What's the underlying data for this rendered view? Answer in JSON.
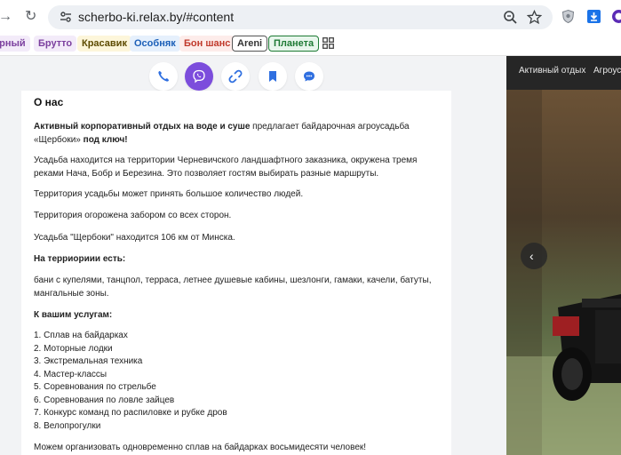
{
  "browser": {
    "url": "scherbo-ki.relax.by/#content"
  },
  "bookmarks": [
    {
      "label": "ерный",
      "color": "#7b3f9e",
      "bg": "#f3ebf9"
    },
    {
      "label": "Брутто",
      "color": "#7b3f9e",
      "bg": "#f3ebf9"
    },
    {
      "label": "Красавик",
      "color": "#5c4a00",
      "bg": "#fdf6da"
    },
    {
      "label": "Особняк",
      "color": "#1b5fb8",
      "bg": "#e6f0fc"
    },
    {
      "label": "Бон шанс",
      "color": "#c0392b",
      "bg": "#fdecea"
    },
    {
      "label": "Areni",
      "color": "#333333",
      "bg": "#ffffff"
    },
    {
      "label": "Планета",
      "color": "#1e7a34",
      "bg": "#e8f6ec"
    }
  ],
  "contacts": [
    "phone-icon",
    "viber-icon",
    "link-icon",
    "bookmark-icon",
    "chat-icon"
  ],
  "right_nav": {
    "item1": "Активный отдых",
    "item2": "Агроус"
  },
  "content": {
    "title": "О нас",
    "intro_bold_1": "Активный корпоративный отдых на воде и суше",
    "intro_mid": " предлагает байдарочная агроусадьба «Щербоки» ",
    "intro_bold_2": "под ключ!",
    "p1": "Усадьба находится на территории Черневичского ландшафтного заказника, окружена тремя реками Нача, Бобр и Березина. Это позволяет гостям выбирать разные маршруты.",
    "p2": "Территория усадьбы может принять большое количество людей.",
    "p3": "Территория огорожена забором со всех сторон.",
    "p4": "Усадьба \"Щербоки\" находится 106 км от Минска.",
    "h_territory": "На терриориии есть:",
    "p5": "бани с купелями, танцпол, терраса, летнее душевые кабины, шезлонги, гамаки, качели, батуты, мангальные зоны.",
    "h_services": "К вашим услугам:",
    "services": [
      "1. Сплав на байдарках",
      "2. Моторные лодки",
      "3. Экстремальная техника",
      "4. Мастер-классы",
      "5. Соревнования по стрельбе",
      "6. Соревнования по ловле зайцев",
      "7. Конкурс команд по распиловке и рубке дров",
      "8. Велопрогулки"
    ],
    "footer": "Можем организовать одновременно сплав на байдарках восьмидесяти человек!"
  },
  "colors": {
    "accent": "#7c4ddc",
    "icon_blue": "#2f6fe0"
  }
}
